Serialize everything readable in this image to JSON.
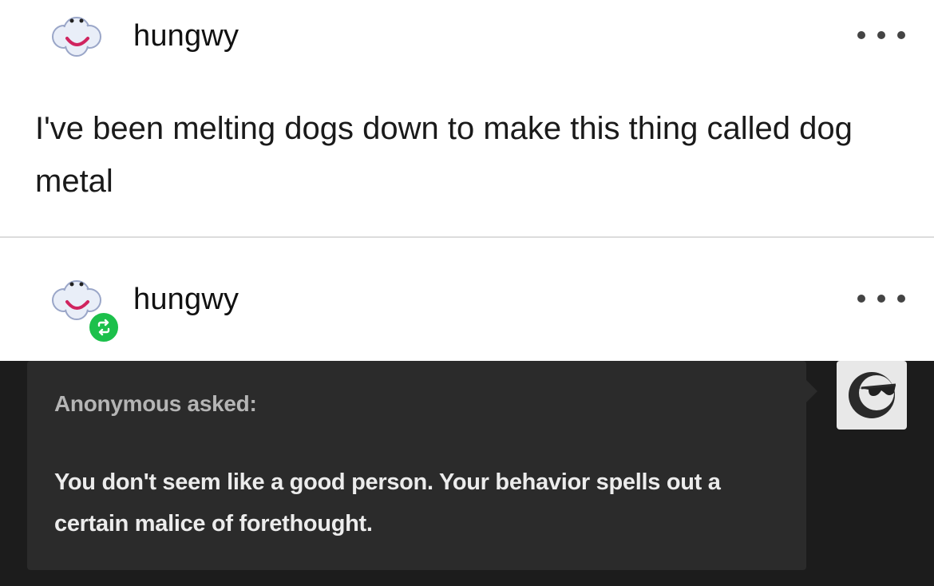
{
  "post": {
    "username": "hungwy",
    "text": "I've been melting dogs down to make this thing called dog metal",
    "avatar_icon": "cloud-smiley-avatar-icon",
    "menu_icon": "more-dots-icon"
  },
  "reblog": {
    "username": "hungwy",
    "avatar_icon": "cloud-smiley-avatar-icon",
    "badge_icon": "reblog-arrows-icon",
    "badge_color": "#1cc04b",
    "menu_icon": "more-dots-icon"
  },
  "ask": {
    "label": "Anonymous asked:",
    "question": "You don't seem like a good person. Your behavior spells out a certain malice of forethought.",
    "avatar_icon": "anonymous-sunglasses-icon",
    "background_color": "#1c1c1c",
    "bubble_color": "#2b2b2b"
  }
}
